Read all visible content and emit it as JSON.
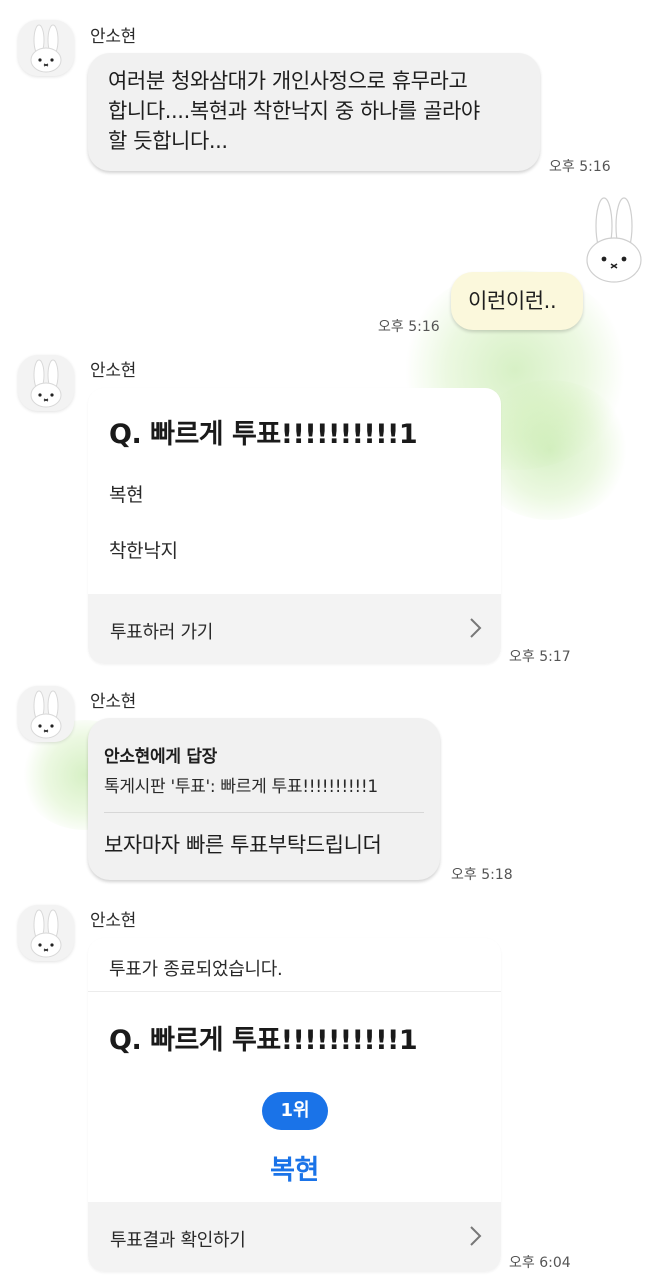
{
  "colors": {
    "incoming_bubble": "#f1f1f1",
    "outgoing_bubble": "#fbf8dc",
    "rank_badge": "#1a73e8",
    "winner_text": "#1a73e8",
    "card_footer": "#f3f3f3"
  },
  "messages": [
    {
      "sender": "안소현",
      "lines": [
        "여러분 청와삼대가 개인사정으로 휴무라고",
        "합니다....복현과 착한낙지 중 하나를 골라야",
        "할 듯합니다..."
      ],
      "time": "오후 5:16"
    },
    {
      "text": "이런이런..",
      "time": "오후 5:16",
      "avatar_icon": "bunny-icon"
    },
    {
      "sender": "안소현",
      "question": "Q. 빠르게 투표!!!!!!!!!!1",
      "options": [
        "복현",
        "착한낙지"
      ],
      "action": "투표하러 가기",
      "time": "오후 5:17"
    },
    {
      "sender": "안소현",
      "reply_to": "안소현에게 답장",
      "reply_quote": "톡게시판 '투표': 빠르게 투표!!!!!!!!!!1",
      "text": "보자마자 빠른 투표부탁드립니더",
      "time": "오후 5:18"
    },
    {
      "sender": "안소현",
      "notice": "투표가 종료되었습니다.",
      "question": "Q. 빠르게 투표!!!!!!!!!!1",
      "rank": "1위",
      "winner": "복현",
      "action": "투표결과 확인하기",
      "time": "오후 6:04"
    }
  ]
}
